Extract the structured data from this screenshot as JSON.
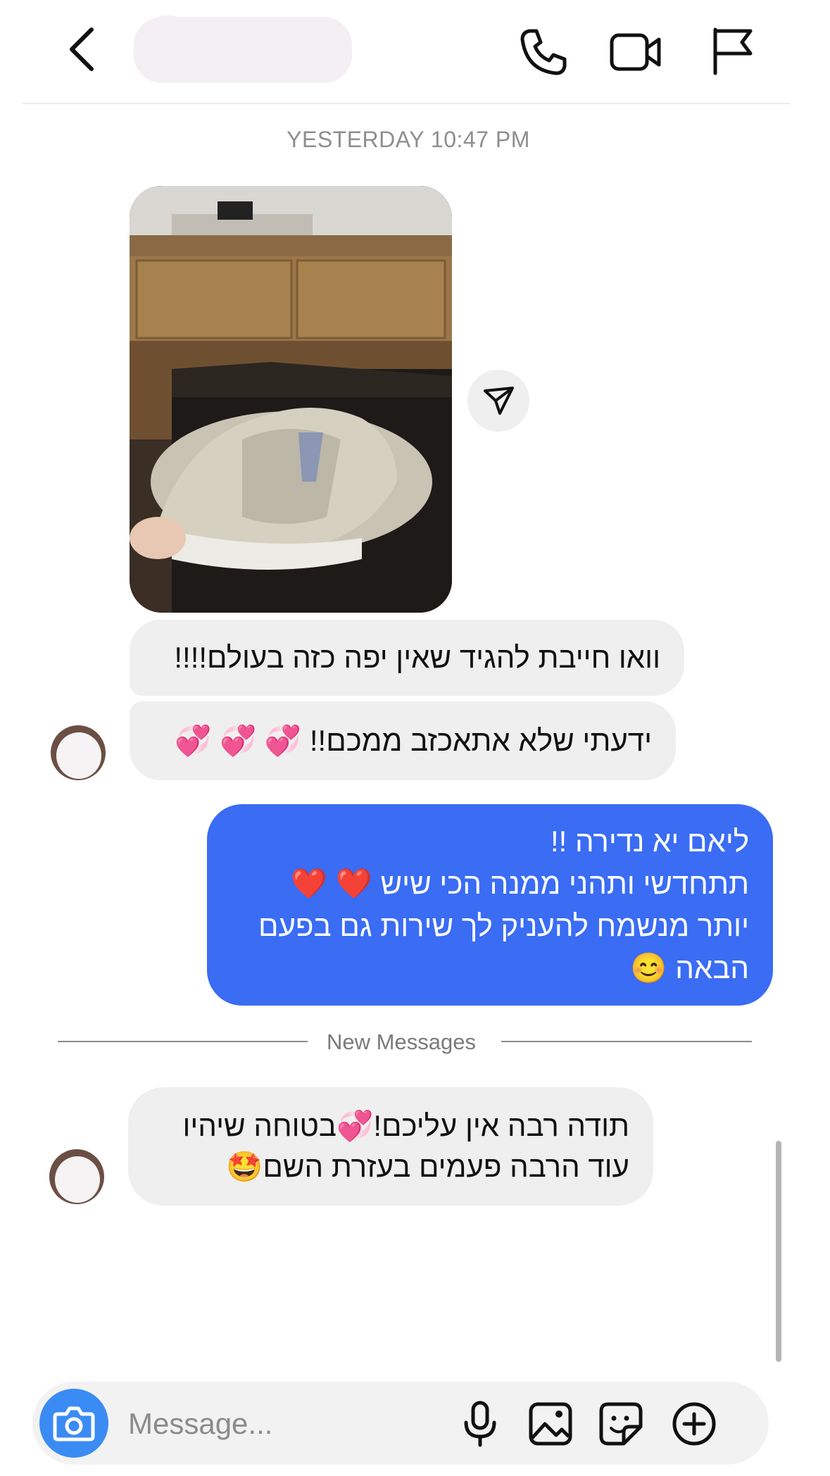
{
  "header": {
    "back_icon": "chevron-left-icon",
    "call_icon": "phone-icon",
    "video_icon": "video-camera-icon",
    "flag_icon": "flag-icon"
  },
  "thread": {
    "timestamp": "YESTERDAY 10:47 PM",
    "new_messages_label": "New Messages"
  },
  "messages": [
    {
      "from": "them",
      "type": "photo",
      "share_icon": "paper-plane-icon"
    },
    {
      "from": "them",
      "lines": [
        "וואו חייבת להגיד שאין יפה כזה בעולם!!!!"
      ]
    },
    {
      "from": "them",
      "lines": [
        "ידעתי שלא אתאכזב ממכם!! 💞 💞 💞"
      ]
    },
    {
      "from": "me",
      "lines": [
        "ליאם יא נדירה !!",
        "תתחדשי ותהני ממנה הכי שיש ❤️ ❤️",
        "יותר מנשמח להעניק לך שירות גם בפעם",
        "הבאה 😊"
      ]
    },
    {
      "from": "them",
      "lines": [
        "תודה רבה אין עליכם!💞בטוחה שיהיו",
        "עוד הרבה פעמים בעזרת השם🤩"
      ]
    }
  ],
  "composer": {
    "placeholder": "Message...",
    "camera_icon": "camera-icon",
    "mic_icon": "microphone-icon",
    "gallery_icon": "image-icon",
    "sticker_icon": "sticker-icon",
    "add_icon": "plus-circle-icon"
  },
  "colors": {
    "outgoing_bubble": "#3a6cf4",
    "incoming_bubble": "#efefef",
    "camera_button": "#3b8bf5"
  }
}
